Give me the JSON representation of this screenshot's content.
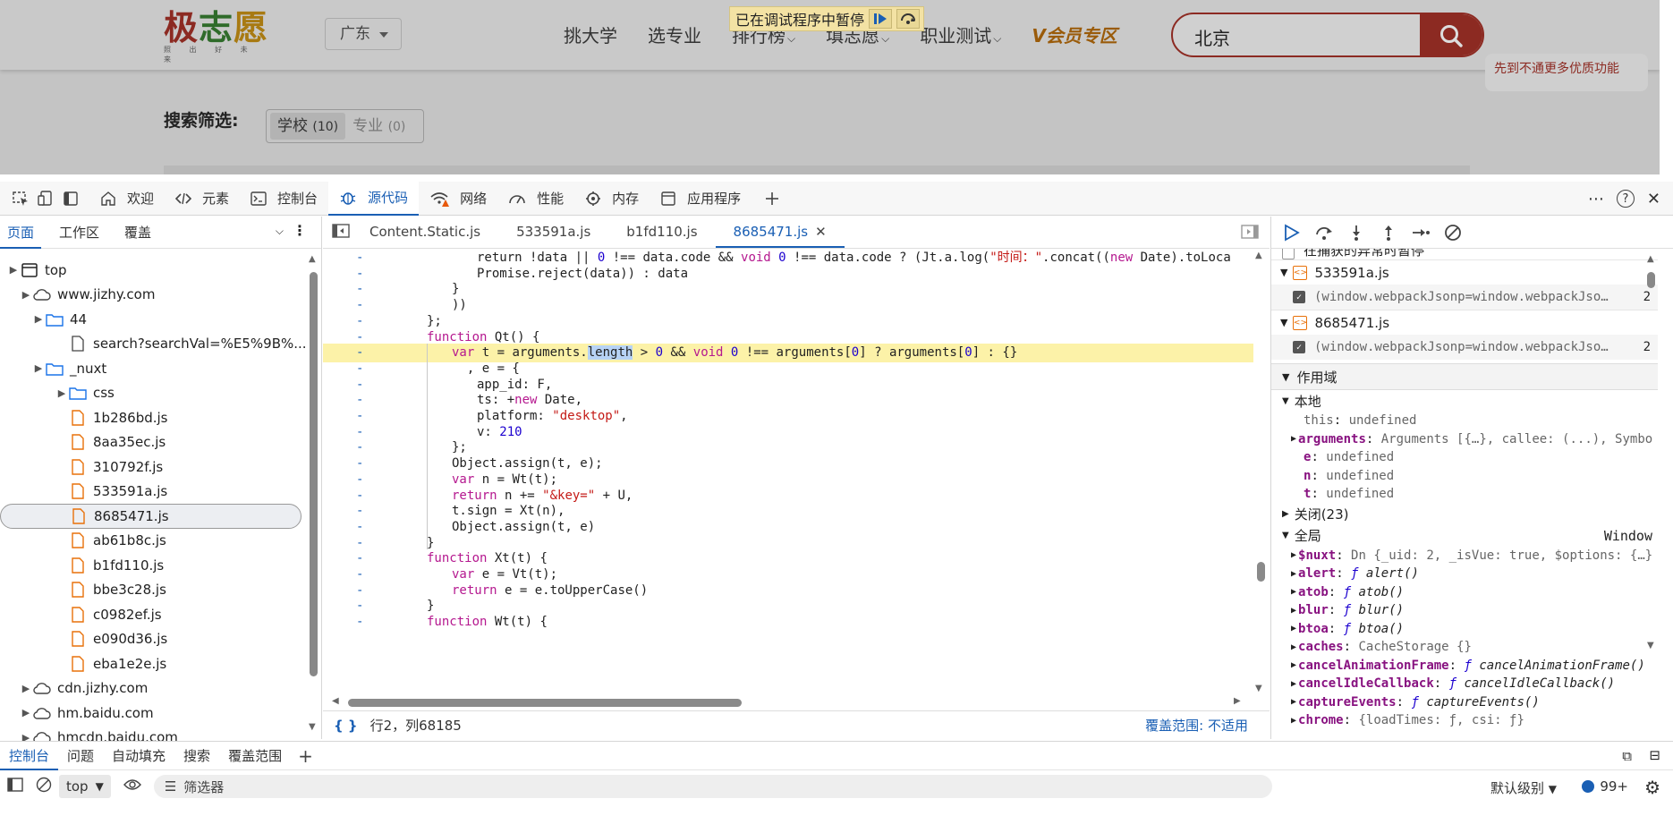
{
  "webpage": {
    "logo_text": [
      "极",
      "志",
      "愿"
    ],
    "logo_sub": "照 出 好 未 来",
    "region": "广东",
    "nav": [
      {
        "label": "挑大学",
        "dropdown": false
      },
      {
        "label": "选专业",
        "dropdown": false
      },
      {
        "label": "排行榜",
        "dropdown": true
      },
      {
        "label": "填志愿",
        "dropdown": true
      },
      {
        "label": "职业测试",
        "dropdown": true
      }
    ],
    "vip_label": "会员专区",
    "search_value": "北京",
    "promo_text": "先到不通更多优质功能",
    "filter_label": "搜索筛选:",
    "filter_tabs": [
      {
        "label": "学校",
        "count": "(10)",
        "active": true
      },
      {
        "label": "专业",
        "count": "(0)",
        "active": false
      }
    ]
  },
  "paused_banner": "已在调试程序中暂停",
  "devtools": {
    "tabs": [
      {
        "label": "欢迎",
        "icon": "home-icon"
      },
      {
        "label": "元素",
        "icon": "code-icon"
      },
      {
        "label": "控制台",
        "icon": "console-icon"
      },
      {
        "label": "源代码",
        "icon": "bug-icon",
        "active": true
      },
      {
        "label": "网络",
        "icon": "wifi-icon"
      },
      {
        "label": "性能",
        "icon": "gauge-icon"
      },
      {
        "label": "内存",
        "icon": "memory-icon"
      },
      {
        "label": "应用程序",
        "icon": "app-icon"
      }
    ],
    "left_tabs": [
      "页面",
      "工作区",
      "覆盖"
    ],
    "tree": [
      {
        "label": "top",
        "level": 0,
        "arrow": "▶",
        "icon": "frame"
      },
      {
        "label": "www.jizhy.com",
        "level": 1,
        "arrow": "▶",
        "icon": "cloud"
      },
      {
        "label": "44",
        "level": 2,
        "arrow": "▶",
        "icon": "folder"
      },
      {
        "label": "search?searchVal=%E5%9B%...",
        "level": 3,
        "arrow": "",
        "icon": "file-plain"
      },
      {
        "label": "_nuxt",
        "level": 2,
        "arrow": "▶",
        "icon": "folder"
      },
      {
        "label": "css",
        "level": 3,
        "arrow": "▶",
        "icon": "folder"
      },
      {
        "label": "1b286bd.js",
        "level": 3,
        "arrow": "",
        "icon": "file-js"
      },
      {
        "label": "8aa35ec.js",
        "level": 3,
        "arrow": "",
        "icon": "file-js"
      },
      {
        "label": "310792f.js",
        "level": 3,
        "arrow": "",
        "icon": "file-js"
      },
      {
        "label": "533591a.js",
        "level": 3,
        "arrow": "",
        "icon": "file-js"
      },
      {
        "label": "8685471.js",
        "level": 3,
        "arrow": "",
        "icon": "file-js",
        "selected": true
      },
      {
        "label": "ab61b8c.js",
        "level": 3,
        "arrow": "",
        "icon": "file-js"
      },
      {
        "label": "b1fd110.js",
        "level": 3,
        "arrow": "",
        "icon": "file-js"
      },
      {
        "label": "bbe3c28.js",
        "level": 3,
        "arrow": "",
        "icon": "file-js"
      },
      {
        "label": "c0982ef.js",
        "level": 3,
        "arrow": "",
        "icon": "file-js"
      },
      {
        "label": "e090d36.js",
        "level": 3,
        "arrow": "",
        "icon": "file-js"
      },
      {
        "label": "eba1e2e.js",
        "level": 3,
        "arrow": "",
        "icon": "file-js"
      },
      {
        "label": "cdn.jizhy.com",
        "level": 1,
        "arrow": "▶",
        "icon": "cloud"
      },
      {
        "label": "hm.baidu.com",
        "level": 1,
        "arrow": "▶",
        "icon": "cloud"
      },
      {
        "label": "hmcdn.baidu.com",
        "level": 1,
        "arrow": "▶",
        "icon": "cloud"
      }
    ],
    "editor_tabs": [
      {
        "label": "Content.Static.js"
      },
      {
        "label": "533591a.js"
      },
      {
        "label": "b1fd110.js"
      },
      {
        "label": "8685471.js",
        "active": true
      }
    ],
    "code_lines": [
      {
        "indent": 4,
        "html": "return !data || <span class='num'>0</span> !== data.code && <span class='kw'>void</span> <span class='num'>0</span> !== data.code ? (Jt.a.log(<span class='str'>\"时间：\"</span>.concat((<span class='kw'>new</span> Date).toLoca"
      },
      {
        "indent": 4,
        "html": "Promise.reject(data)) : data"
      },
      {
        "indent": 3,
        "html": "}"
      },
      {
        "indent": 3,
        "html": "))"
      },
      {
        "indent": 2,
        "html": "};"
      },
      {
        "indent": 2,
        "html": "<span class='kw'>function</span> Qt() {"
      },
      {
        "indent": 3,
        "html": "<span class='kw'>var</span> t = arguments.<span class='sel'>length</span> &gt; <span class='num'>0</span> && <span class='kw'>void</span> <span class='num'>0</span> !== arguments[<span class='num'>0</span>] ? arguments[<span class='num'>0</span>] : {}",
        "highlight": true
      },
      {
        "indent": 3,
        "html": "  , e = {"
      },
      {
        "indent": 4,
        "html": "app_id: F,"
      },
      {
        "indent": 4,
        "html": "ts: +<span class='kw'>new</span> Date,"
      },
      {
        "indent": 4,
        "html": "platform: <span class='str'>\"desktop\"</span>,"
      },
      {
        "indent": 4,
        "html": "v: <span class='num'>210</span>"
      },
      {
        "indent": 3,
        "html": "};"
      },
      {
        "indent": 3,
        "html": "Object.assign(t, e);"
      },
      {
        "indent": 3,
        "html": "<span class='kw'>var</span> n = Wt(t);"
      },
      {
        "indent": 3,
        "html": "<span class='kw'>return</span> n += <span class='str'>\"&key=\"</span> + U,"
      },
      {
        "indent": 3,
        "html": "t.sign = Xt(n),"
      },
      {
        "indent": 3,
        "html": "Object.assign(t, e)"
      },
      {
        "indent": 2,
        "html": "}"
      },
      {
        "indent": 2,
        "html": "<span class='kw'>function</span> Xt(t) {"
      },
      {
        "indent": 3,
        "html": "<span class='kw'>var</span> e = Vt(t);"
      },
      {
        "indent": 3,
        "html": "<span class='kw'>return</span> e = e.toUpperCase()"
      },
      {
        "indent": 2,
        "html": "}"
      },
      {
        "indent": 2,
        "html": "<span class='kw'>function</span> Wt(t) {"
      }
    ],
    "gutter_mark": "-",
    "status_position": "行2，列68185",
    "status_coverage": "覆盖范围: 不适用",
    "breakpoint_cut_label": "在捕获的异常时暂停",
    "breakpoints": [
      {
        "file": "533591a.js",
        "snippet": "(window.webpackJsonp=window.webpackJso…",
        "line": "2"
      },
      {
        "file": "8685471.js",
        "snippet": "(window.webpackJsonp=window.webpackJso…",
        "line": "2"
      }
    ],
    "scope_title": "作用域",
    "local_label": "本地",
    "local_vars": [
      {
        "name": "this",
        "value": "undefined",
        "plain": true
      },
      {
        "name": "arguments",
        "value": "Arguments [{…}, callee: (...), Symbo",
        "expandable": true
      },
      {
        "name": "e",
        "value": "undefined"
      },
      {
        "name": "n",
        "value": "undefined"
      },
      {
        "name": "t",
        "value": "undefined"
      }
    ],
    "closure_label": "关闭(23)",
    "global_label": "全局",
    "global_value": "Window",
    "global_vars": [
      {
        "name": "$nuxt",
        "value": "Dn {_uid: 2, _isVue: true, $options: {…}"
      },
      {
        "name": "alert",
        "fn": "alert()"
      },
      {
        "name": "atob",
        "fn": "atob()"
      },
      {
        "name": "blur",
        "fn": "blur()"
      },
      {
        "name": "btoa",
        "fn": "btoa()"
      },
      {
        "name": "caches",
        "value": "CacheStorage {}"
      },
      {
        "name": "cancelAnimationFrame",
        "fn": "cancelAnimationFrame()"
      },
      {
        "name": "cancelIdleCallback",
        "fn": "cancelIdleCallback()"
      },
      {
        "name": "captureEvents",
        "fn": "captureEvents()"
      },
      {
        "name": "chrome",
        "value": "{loadTimes: ƒ, csi: ƒ}"
      }
    ],
    "drawer_tabs": [
      "控制台",
      "问题",
      "自动填充",
      "搜索",
      "覆盖范围"
    ],
    "context": "top",
    "filter_placeholder": "筛选器",
    "log_level": "默认级别",
    "issue_count": "99+"
  }
}
